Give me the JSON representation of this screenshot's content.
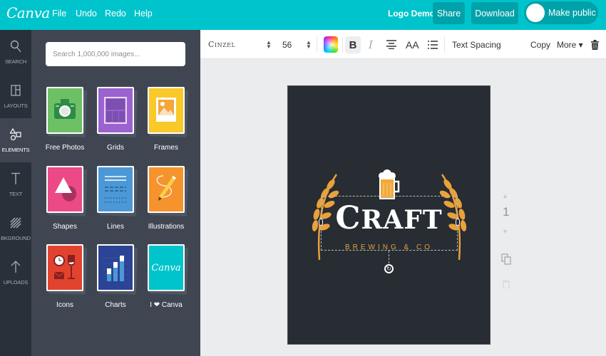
{
  "topbar": {
    "logo": "Canva",
    "menu": [
      "File",
      "Undo",
      "Redo",
      "Help"
    ],
    "doc_title": "Logo Demo",
    "share": "Share",
    "download": "Download",
    "make_public": "Make public",
    "brand_color": "#00c4cc"
  },
  "rail": {
    "items": [
      {
        "label": "SEARCH",
        "icon": "search-icon"
      },
      {
        "label": "LAYOUTS",
        "icon": "layouts-icon"
      },
      {
        "label": "ELEMENTS",
        "icon": "elements-icon",
        "active": true
      },
      {
        "label": "TEXT",
        "icon": "text-icon"
      },
      {
        "label": "BKGROUND",
        "icon": "background-icon"
      },
      {
        "label": "UPLOADS",
        "icon": "upload-icon"
      }
    ]
  },
  "panel": {
    "search_placeholder": "Search 1,000,000 images...",
    "tiles": [
      {
        "label": "Free Photos",
        "color": "#6dc065"
      },
      {
        "label": "Grids",
        "color": "#9b63cf"
      },
      {
        "label": "Frames",
        "color": "#f9c829"
      },
      {
        "label": "Shapes",
        "color": "#ec4a87"
      },
      {
        "label": "Lines",
        "color": "#4c98d6"
      },
      {
        "label": "Illustrations",
        "color": "#f6932d"
      },
      {
        "label": "Icons",
        "color": "#e2432f"
      },
      {
        "label": "Charts",
        "color": "#2c4495"
      },
      {
        "label": "I ❤ Canva",
        "color": "#00c4cc"
      }
    ],
    "canva_tile_text": "Canva"
  },
  "toolbar": {
    "font": "Cinzel",
    "size": "56",
    "bold": "B",
    "italic": "I",
    "align": "≡",
    "case": "AA",
    "list": "☰",
    "text_spacing": "Text Spacing",
    "copy": "Copy",
    "more": "More ▾"
  },
  "canvas": {
    "title": "CRAFT",
    "subtitle": "BREWING & CO",
    "page_number": "1",
    "accent": "#e9a13a"
  }
}
